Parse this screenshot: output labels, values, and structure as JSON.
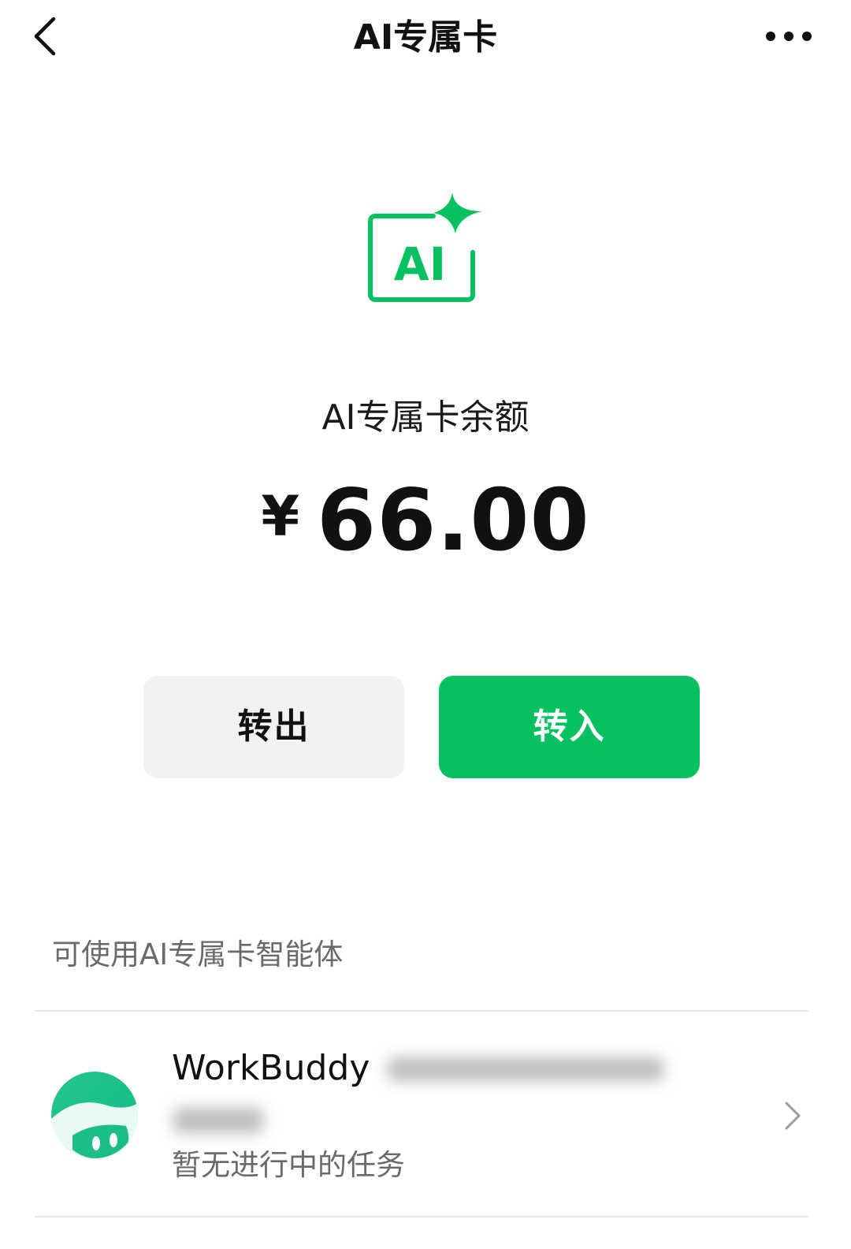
{
  "header": {
    "title": "AI专属卡",
    "back_icon": "chevron-left-icon",
    "more_icon": "more-horizontal-icon"
  },
  "hero": {
    "logo_icon": "ai-sparkle-icon",
    "logo_text": "AI",
    "balance_label": "AI专属卡余额",
    "currency_symbol": "¥",
    "balance_amount": "66.00"
  },
  "actions": {
    "transfer_out_label": "转出",
    "transfer_in_label": "转入"
  },
  "agents_section": {
    "title": "可使用AI专属卡智能体",
    "items": [
      {
        "name": "WorkBuddy",
        "status": "暂无进行中的任务",
        "avatar_icon": "workbuddy-avatar-icon",
        "chevron_icon": "chevron-right-icon"
      }
    ]
  },
  "colors": {
    "brand_green": "#07c160",
    "button_gray": "#f2f2f2",
    "secondary_text": "#6a6a6a",
    "divider": "#e6e6e6"
  }
}
